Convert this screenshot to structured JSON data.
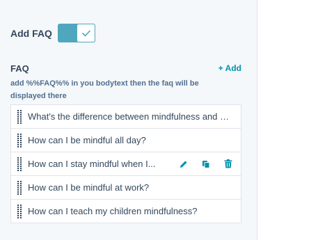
{
  "toggle": {
    "label": "Add FAQ",
    "enabled": true
  },
  "faq": {
    "title": "FAQ",
    "add_label": "+ Add",
    "help_text": "add %%FAQ%% in you bodytext then the faq will be displayed there",
    "items": [
      {
        "question": "What's the difference between mindfulness and meditation?"
      },
      {
        "question": "How can I be mindful all day?"
      },
      {
        "question": "How can I stay mindful when I..."
      },
      {
        "question": "How can I be mindful at work?"
      },
      {
        "question": "How can I teach my children mindfulness?"
      }
    ]
  },
  "colors": {
    "accent": "#0091ae",
    "toggle_on": "#4fa7bd",
    "text": "#33475b",
    "border": "#dfe3eb",
    "panel_bg": "#f5f8fa"
  },
  "icons": {
    "toggle_check": "check-icon",
    "drag": "drag-handle-icon",
    "edit": "pencil-icon",
    "clone": "copy-icon",
    "delete": "trash-icon"
  }
}
